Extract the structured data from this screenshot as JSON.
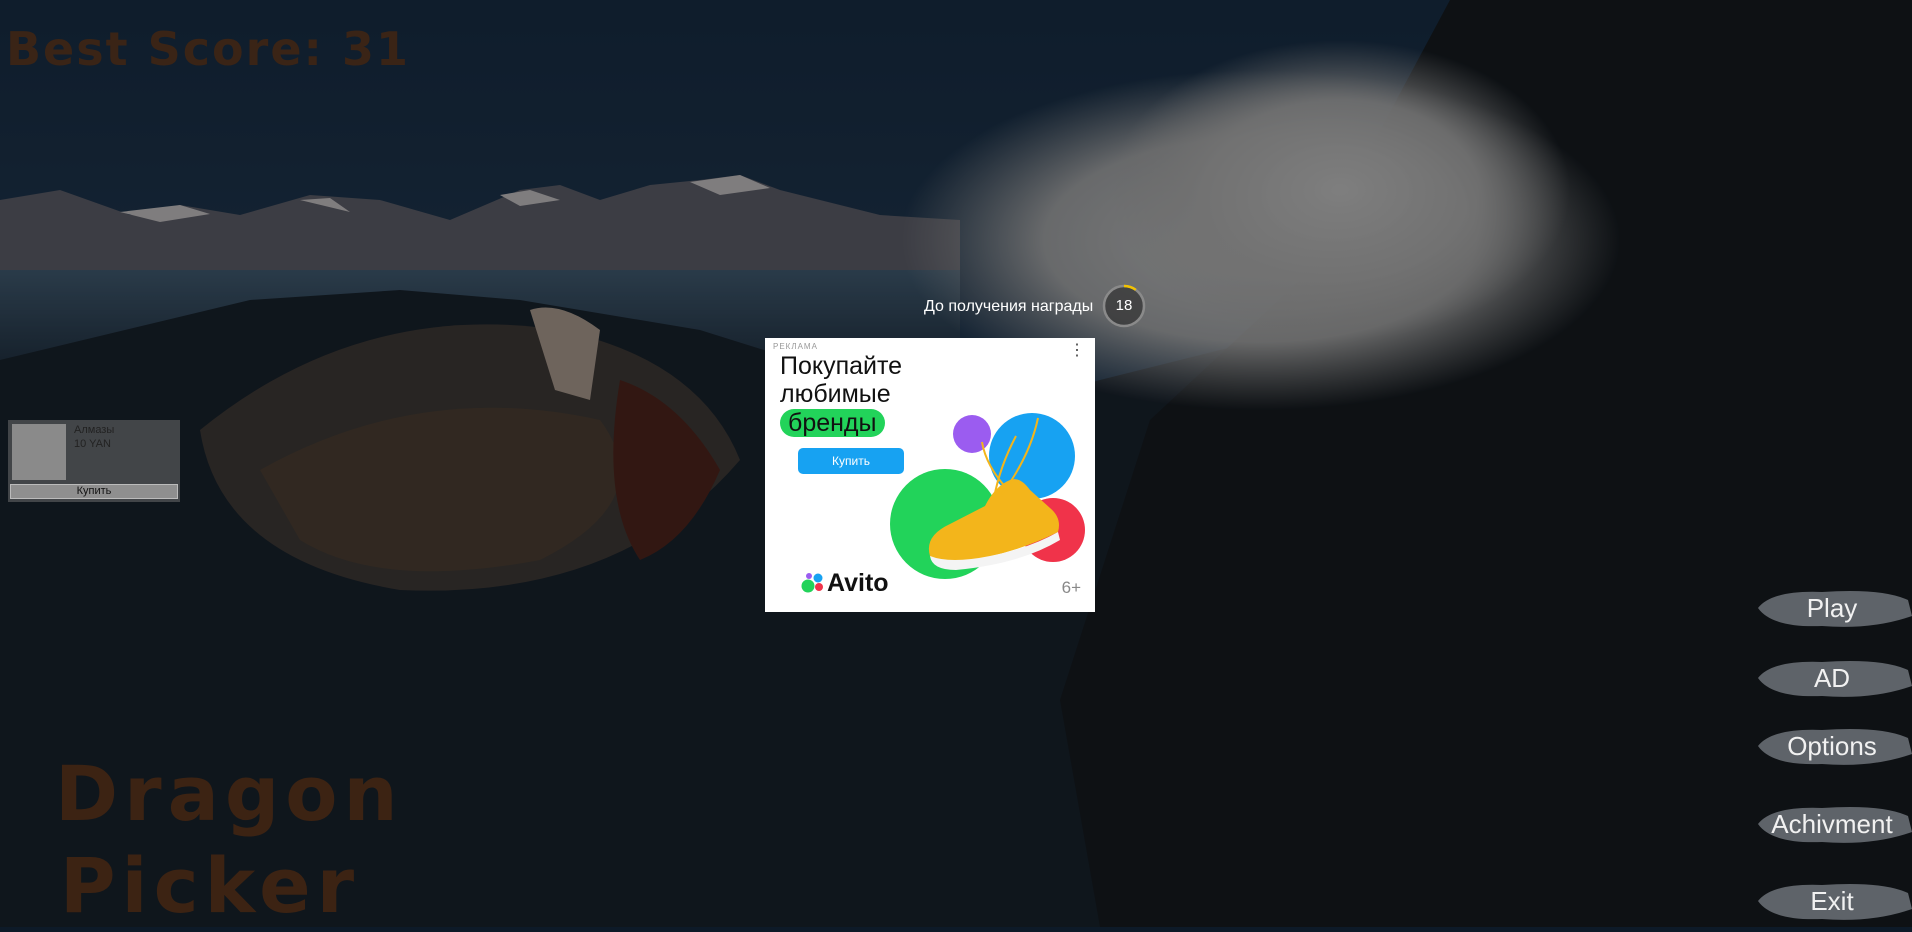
{
  "hud": {
    "best_score": "Best Score: 31",
    "title_line1": "Dragon",
    "title_line2": "Picker"
  },
  "shop": {
    "item_name": "Алмазы",
    "item_price": "10 YAN",
    "buy_label": "Купить"
  },
  "reward_timer": {
    "label": "До получения награды",
    "seconds": "18",
    "progress": 0.1
  },
  "ad": {
    "label": "РЕКЛАМА",
    "menu_icon": "kebab-menu-icon",
    "headline_line1": "Покупайте",
    "headline_line2": "любимые",
    "headline_line3": "бренды",
    "cta_label": "Купить",
    "brand": "Avito",
    "age_rating": "6+",
    "colors": {
      "green": "#22d35a",
      "blue": "#17a2f2",
      "red": "#f0334a",
      "purple": "#9b5cf0"
    }
  },
  "menu": {
    "play": "Play",
    "ad": "AD",
    "options": "Options",
    "achievement": "Achivment",
    "exit": "Exit"
  }
}
